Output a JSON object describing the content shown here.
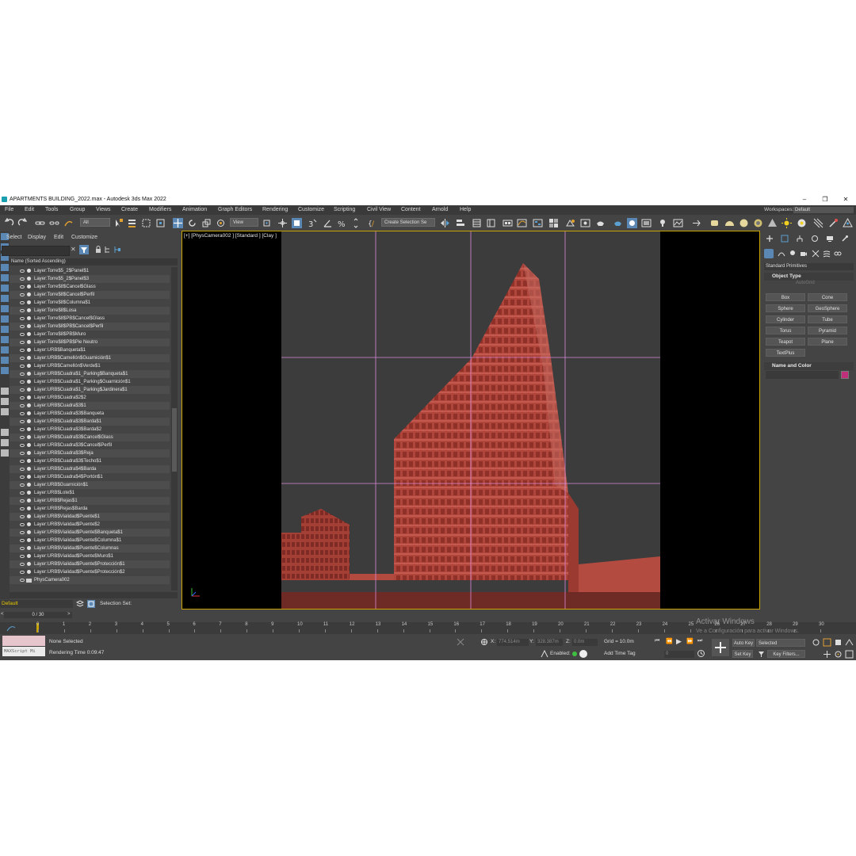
{
  "window": {
    "title": "APARTMENTS BUILDING_2022.max - Autodesk 3ds Max 2022",
    "minimize": "–",
    "maximize": "❐",
    "close": "✕"
  },
  "menu": [
    "File",
    "Edit",
    "Tools",
    "Group",
    "Views",
    "Create",
    "Modifiers",
    "Animation",
    "Graph Editors",
    "Rendering",
    "Customize",
    "Scripting",
    "Civil View",
    "Content",
    "Arnold",
    "Help"
  ],
  "workspace": {
    "label": "Workspaces:",
    "value": "Default"
  },
  "toolbar": {
    "selection_filter": "All",
    "reference_coord": "View",
    "selection_set": "Create Selection Se"
  },
  "scene_explorer": {
    "menu": [
      "Select",
      "Display",
      "Edit",
      "Customize"
    ],
    "column_header": "Name (Sorted Ascending)",
    "items": [
      "Layer:Torre$5_2$Panel$1",
      "Layer:Torre$5_2$Panel$3",
      "Layer:Torre$8$Cancel$Glass",
      "Layer:Torre$8$Cancel$Perfil",
      "Layer:Torre$8$Columna$1",
      "Layer:Torre$8$Losa",
      "Layer:Torre$8$PB$Cancel$Glass",
      "Layer:Torre$8$PB$Cancel$Perfil",
      "Layer:Torre$8$PB$Muro",
      "Layer:Torre$8$PB$Pie Neutro",
      "Layer:URB$Banqueta$1",
      "Layer:URB$Camellón$Guarnición$1",
      "Layer:URB$Camellón$Verde$1",
      "Layer:URB$Cuadra$1_Parking$Banqueta$1",
      "Layer:URB$Cuadra$1_Parking$Guarnición$1",
      "Layer:URB$Cuadra$1_Parking$Jardinera$1",
      "Layer:URB$Cuadra$2$2",
      "Layer:URB$Cuadra$3$1",
      "Layer:URB$Cuadra$3$Banqueta",
      "Layer:URB$Cuadra$3$Barda$1",
      "Layer:URB$Cuadra$3$Barda$2",
      "Layer:URB$Cuadra$3$Cancel$Glass",
      "Layer:URB$Cuadra$3$Cancel$Perfil",
      "Layer:URB$Cuadra$3$Reja",
      "Layer:URB$Cuadra$3$Techo$1",
      "Layer:URB$Cuadra$4$Barda",
      "Layer:URB$Cuadra$4$Portón$1",
      "Layer:URB$Guarnición$1",
      "Layer:URB$Lote$1",
      "Layer:URB$Rejas$1",
      "Layer:URB$Rejas$Barda",
      "Layer:URB$Vialidad$Puente$1",
      "Layer:URB$Vialidad$Puente$2",
      "Layer:URB$Vialidad$Puente$Banqueta$1",
      "Layer:URB$Vialidad$Puente$Columna$1",
      "Layer:URB$Vialidad$Puente$Columnas",
      "Layer:URB$Vialidad$Puente$Muro$1",
      "Layer:URB$Vialidad$Puente$Protección$1",
      "Layer:URB$Vialidad$Puente$Protección$2",
      "PhysCamera002"
    ],
    "layer": "Default",
    "selection_set_label": "Selection Set:"
  },
  "viewport": {
    "label": "[+] [PhysCamera002 ] [Standard ] [Clay ]"
  },
  "command_panel": {
    "category": "Standard Primitives",
    "object_type_title": "Object Type",
    "autogrid": "AutoGrid",
    "buttons": [
      "Box",
      "Cone",
      "Sphere",
      "GeoSphere",
      "Cylinder",
      "Tube",
      "Torus",
      "Pyramid",
      "Teapot",
      "Plane",
      "TextPlus"
    ],
    "name_color_title": "Name and Color",
    "swatch_color": "#c0307a"
  },
  "timeline": {
    "frame": "0 / 30",
    "ticks": [
      "0",
      "1",
      "2",
      "3",
      "4",
      "5",
      "6",
      "7",
      "8",
      "9",
      "10",
      "11",
      "12",
      "13",
      "14",
      "15",
      "16",
      "17",
      "18",
      "19",
      "20",
      "21",
      "22",
      "23",
      "24",
      "25",
      "26",
      "27",
      "28",
      "29",
      "30"
    ]
  },
  "status": {
    "maxscript": "MAXScript Mi",
    "selection": "None Selected",
    "render_time": "Rendering Time  0:09:47",
    "x_label": "X:",
    "x_value": "774.514m",
    "y_label": "Y:",
    "y_value": "328.387m",
    "z_label": "Z:",
    "z_value": "0.0m",
    "grid": "Grid = 10.0m",
    "enabled": "Enabled:",
    "add_time_tag": "Add Time Tag",
    "auto_key": "Auto Key",
    "set_key": "Set Key",
    "key_mode": "Selected",
    "key_filters": "Key Filters...",
    "current_frame": "0"
  },
  "watermark": {
    "title": "Activar Windows",
    "sub": "Ve a Configuración para activar Windows."
  }
}
